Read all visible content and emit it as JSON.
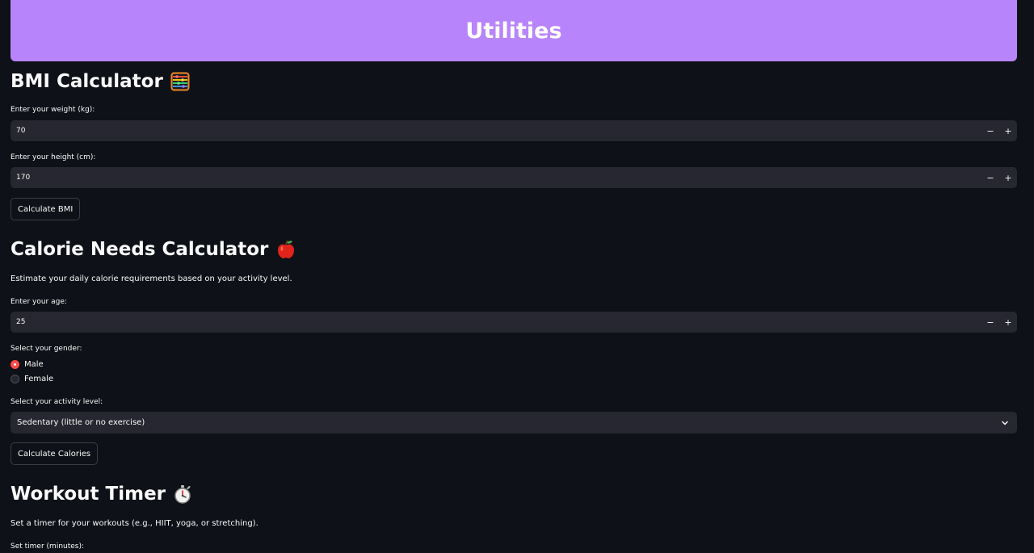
{
  "header": {
    "title": "Utilities"
  },
  "bmi": {
    "heading": "BMI Calculator",
    "weight_label": "Enter your weight (kg):",
    "weight_value": "70",
    "height_label": "Enter your height (cm):",
    "height_value": "170",
    "button": "Calculate BMI",
    "icon": "abacus-icon"
  },
  "calorie": {
    "heading": "Calorie Needs Calculator",
    "description": "Estimate your daily calorie requirements based on your activity level.",
    "age_label": "Enter your age:",
    "age_value": "25",
    "gender_label": "Select your gender:",
    "gender_options": [
      "Male",
      "Female"
    ],
    "gender_selected": "Male",
    "activity_label": "Select your activity level:",
    "activity_value": "Sedentary (little or no exercise)",
    "button": "Calculate Calories",
    "icon": "apple-icon"
  },
  "timer": {
    "heading": "Workout Timer",
    "description": "Set a timer for your workouts (e.g., HIIT, yoga, or stretching).",
    "minutes_label": "Set timer (minutes):",
    "icon": "stopwatch-icon"
  },
  "stepper": {
    "minus": "−",
    "plus": "+"
  },
  "colors": {
    "background": "#0e1117",
    "banner": "#b884fb",
    "input_bg": "#262730",
    "radio_accent": "#ff4b4b"
  }
}
